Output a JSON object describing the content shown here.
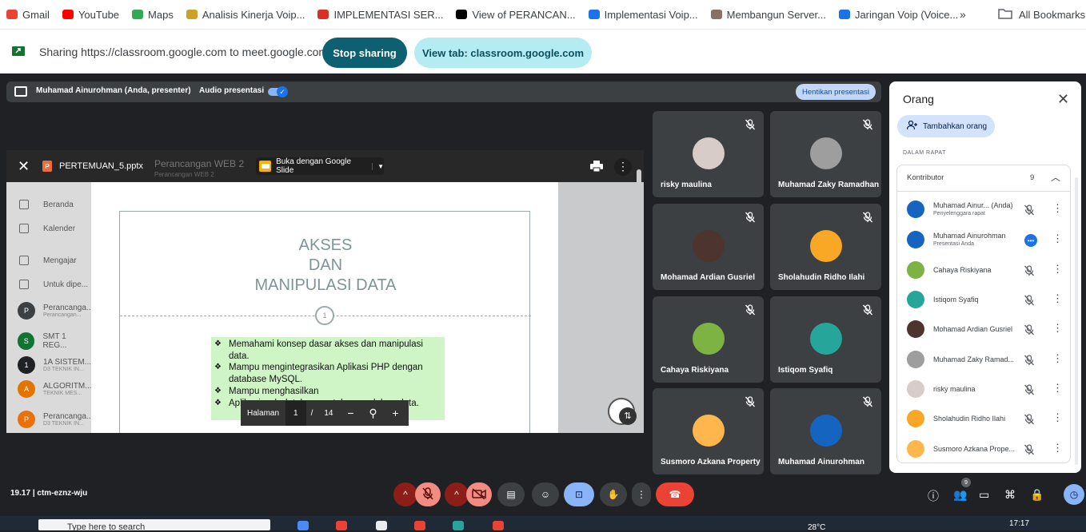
{
  "bookmarks": [
    {
      "label": "Gmail",
      "icon": "gmail-icon",
      "color": "#ea4335"
    },
    {
      "label": "YouTube",
      "icon": "youtube-icon",
      "color": "#ff0000"
    },
    {
      "label": "Maps",
      "icon": "maps-icon",
      "color": "#34a853"
    },
    {
      "label": "Analisis Kinerja Voip...",
      "icon": "coin-icon",
      "color": "#c9a227"
    },
    {
      "label": "IMPLEMENTASI SER...",
      "icon": "download-icon",
      "color": "#d93025"
    },
    {
      "label": "View of PERANCAN...",
      "icon": "pkp-icon",
      "color": "#000000"
    },
    {
      "label": "Implementasi Voip...",
      "icon": "network-icon",
      "color": "#1a73e8"
    },
    {
      "label": "Membangun Server...",
      "icon": "badge-icon",
      "color": "#8d6e63"
    },
    {
      "label": "Jaringan Voip (Voice...",
      "icon": "network-icon",
      "color": "#1a73e8"
    }
  ],
  "bookmarks_more": "»",
  "all_bookmarks": "All Bookmarks",
  "sharing": {
    "text": "Sharing https://classroom.google.com to meet.google.com",
    "stop_label": "Stop sharing",
    "view_label": "View tab: classroom.google.com"
  },
  "presenter": {
    "name": "Muhamad Ainurohman (Anda, presenter)",
    "audio_label": "Audio presentasi",
    "stop_label": "Hentikan presentasi"
  },
  "viewer": {
    "file_name": "PERTEMUAN_5.pptx",
    "bg_title": "Perancangan WEB 2",
    "bg_subtitle": "Perancangan WEB 2",
    "open_with": "Buka dengan Google Slide"
  },
  "classroom_items": [
    {
      "label": "Beranda",
      "sub": ""
    },
    {
      "label": "Kalender",
      "sub": ""
    },
    {
      "label": "Mengajar",
      "sub": ""
    },
    {
      "label": "Untuk dipe...",
      "sub": ""
    },
    {
      "label": "Perancanga...",
      "sub": "Perancangan...",
      "avatar": "P",
      "color": "#3c4043"
    },
    {
      "label": "SMT 1 REG...",
      "sub": "",
      "avatar": "S",
      "color": "#137333"
    },
    {
      "label": "1A SISTEM...",
      "sub": "D3 TEKNIK IN...",
      "avatar": "1",
      "color": "#202124"
    },
    {
      "label": "ALGORITM...",
      "sub": "TEKNIK MES...",
      "avatar": "A",
      "color": "#e37400"
    },
    {
      "label": "Perancanga...",
      "sub": "D3 TEKNIK IN...",
      "avatar": "P",
      "color": "#e8710a"
    }
  ],
  "slide": {
    "title_lines": [
      "AKSES",
      "DAN",
      "MANIPULASI DATA"
    ],
    "number": "1",
    "bullets": [
      "Memahami konsep dasar akses dan manipulasi data.",
      "Mampu mengintegrasikan Aplikasi PHP dengan database MySQL.",
      "Mampu menghasilkan",
      "Aplikasi web database untuk pengolahan data."
    ]
  },
  "pager": {
    "label": "Halaman",
    "current": "1",
    "sep": "/",
    "total": "14"
  },
  "tiles": [
    {
      "name": "risky maulina",
      "avatar_color": "#d7ccc8"
    },
    {
      "name": "Muhamad Zaky Ramadhan",
      "avatar_color": "#9e9e9e"
    },
    {
      "name": "Mohamad Ardian Gusriel",
      "avatar_color": "#4e342e"
    },
    {
      "name": "Sholahudin Ridho Ilahi",
      "avatar_color": "#f9a825"
    },
    {
      "name": "Cahaya Riskiyana",
      "avatar_color": "#7cb342"
    },
    {
      "name": "Istiqom Syafiq",
      "avatar_color": "#26a69a"
    },
    {
      "name": "Susmoro Azkana Property",
      "avatar_color": "#ffb74d"
    },
    {
      "name": "Muhamad Ainurohman",
      "avatar_color": "#1565c0"
    }
  ],
  "people": {
    "title": "Orang",
    "add_label": "Tambahkan orang",
    "section": "DALAM RAPAT",
    "contributor_label": "Kontributor",
    "count": "9",
    "rows": [
      {
        "name": "Muhamad Ainur...  (Anda)",
        "sub": "Penyelenggara rapat",
        "avatar_color": "#1565c0",
        "state": "muted"
      },
      {
        "name": "Muhamad Ainurohman",
        "sub": "Presentasi Anda",
        "avatar_color": "#1565c0",
        "state": "presenting"
      },
      {
        "name": "Cahaya Riskiyana",
        "sub": "",
        "avatar_color": "#7cb342",
        "state": "muted"
      },
      {
        "name": "Istiqom Syafiq",
        "sub": "",
        "avatar_color": "#26a69a",
        "state": "muted"
      },
      {
        "name": "Mohamad Ardian Gusriel",
        "sub": "",
        "avatar_color": "#4e342e",
        "state": "muted"
      },
      {
        "name": "Muhamad Zaky Ramad...",
        "sub": "",
        "avatar_color": "#9e9e9e",
        "state": "muted"
      },
      {
        "name": "risky maulina",
        "sub": "",
        "avatar_color": "#d7ccc8",
        "state": "muted"
      },
      {
        "name": "Sholahudin Ridho Ilahi",
        "sub": "",
        "avatar_color": "#f9a825",
        "state": "muted"
      },
      {
        "name": "Susmoro Azkana Prope...",
        "sub": "",
        "avatar_color": "#ffb74d",
        "state": "muted"
      }
    ]
  },
  "meeting": {
    "time": "19.17",
    "separator": "|",
    "code": "ctm-eznz-wju",
    "people_badge": "9"
  },
  "taskbar": {
    "search_placeholder": "Type here to search",
    "temp": "28°C",
    "clock": "17:17"
  },
  "colors": {
    "accent": "#0d5f72",
    "end_call": "#ea4335",
    "mic_off": "#8c1d18"
  }
}
